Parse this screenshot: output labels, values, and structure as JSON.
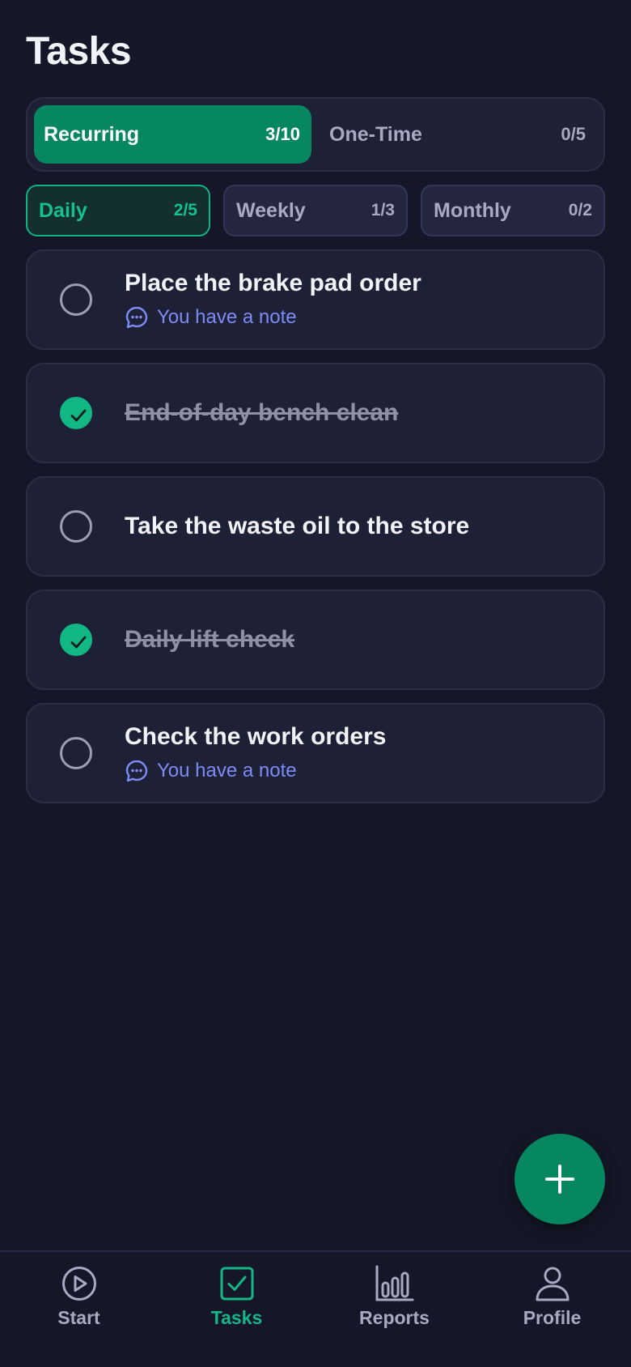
{
  "page_title": "Tasks",
  "segment": [
    {
      "label": "Recurring",
      "count": "3/10",
      "active": true
    },
    {
      "label": "One-Time",
      "count": "0/5",
      "active": false
    }
  ],
  "filters": [
    {
      "label": "Daily",
      "count": "2/5",
      "active": true
    },
    {
      "label": "Weekly",
      "count": "1/3",
      "active": false
    },
    {
      "label": "Monthly",
      "count": "0/2",
      "active": false
    }
  ],
  "tasks": [
    {
      "title": "Place the brake pad order",
      "done": false,
      "note": "You have a note"
    },
    {
      "title": "End-of-day bench clean",
      "done": true,
      "note": ""
    },
    {
      "title": "Take the waste oil to the store",
      "done": false,
      "note": ""
    },
    {
      "title": "Daily lift check",
      "done": true,
      "note": ""
    },
    {
      "title": "Check the work orders",
      "done": false,
      "note": "You have a note"
    }
  ],
  "nav": [
    {
      "label": "Start",
      "icon": "play-circle-icon",
      "active": false
    },
    {
      "label": "Tasks",
      "icon": "checkbox-icon",
      "active": true
    },
    {
      "label": "Reports",
      "icon": "bar-chart-icon",
      "active": false
    },
    {
      "label": "Profile",
      "icon": "user-icon",
      "active": false
    }
  ],
  "colors": {
    "background": "#151728",
    "accent": "#07875f",
    "accent_bright": "#12b884",
    "note": "#7d8cf5"
  }
}
